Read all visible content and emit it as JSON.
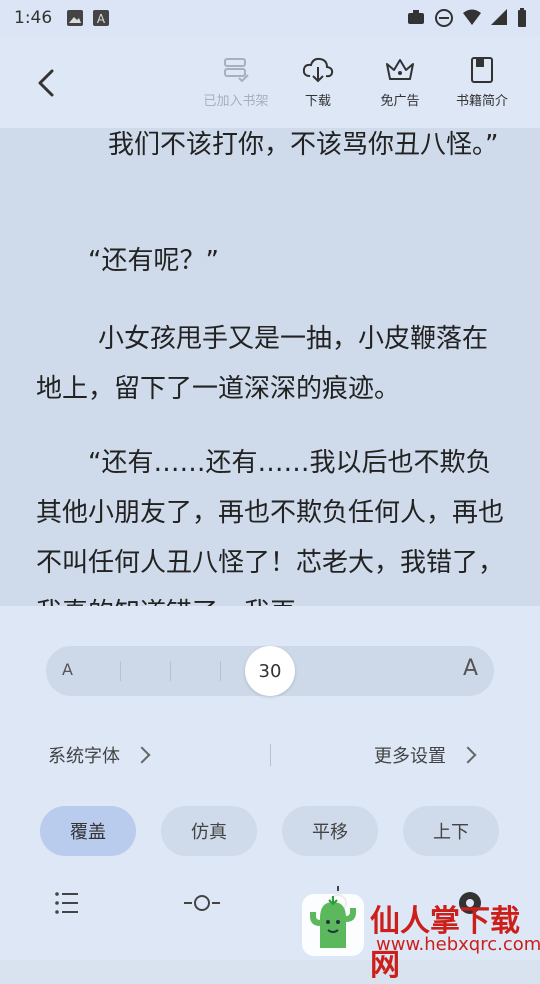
{
  "status": {
    "time": "1:46"
  },
  "toolbar": {
    "items": [
      {
        "label": "已加入书架",
        "state": "disabled",
        "icon": "bookshelf-added-icon"
      },
      {
        "label": "下载",
        "icon": "cloud-download-icon"
      },
      {
        "label": "免广告",
        "icon": "crown-icon"
      },
      {
        "label": "书籍简介",
        "icon": "book-icon"
      }
    ]
  },
  "reader": {
    "paragraphs": [
      "我们不该打你，不该骂你丑八怪。”",
      "“还有呢？”",
      "小女孩甩手又是一抽，小皮鞭落在地上，留下了一道深深的痕迹。",
      "“还有……还有……我以后也不欺负其他小朋友了，再也不欺负任何人，再也不叫任何人丑八怪了！芯老大，我错了，我真的知道错了，我再"
    ]
  },
  "settings": {
    "font_size": {
      "min_label": "A",
      "max_label": "A",
      "value": "30"
    },
    "font_label": "系统字体",
    "more_label": "更多设置",
    "modes": [
      "覆盖",
      "仿真",
      "平移",
      "上下"
    ],
    "selected_mode": "覆盖"
  },
  "watermark": {
    "text": "仙人掌下载网",
    "url": "www.hebxqrc.com"
  },
  "colors": {
    "panel_bg": "#dde7f6",
    "reader_bg": "#cfdaea",
    "selected_mode": "#b9ccee",
    "watermark": "#cc1f1a"
  }
}
